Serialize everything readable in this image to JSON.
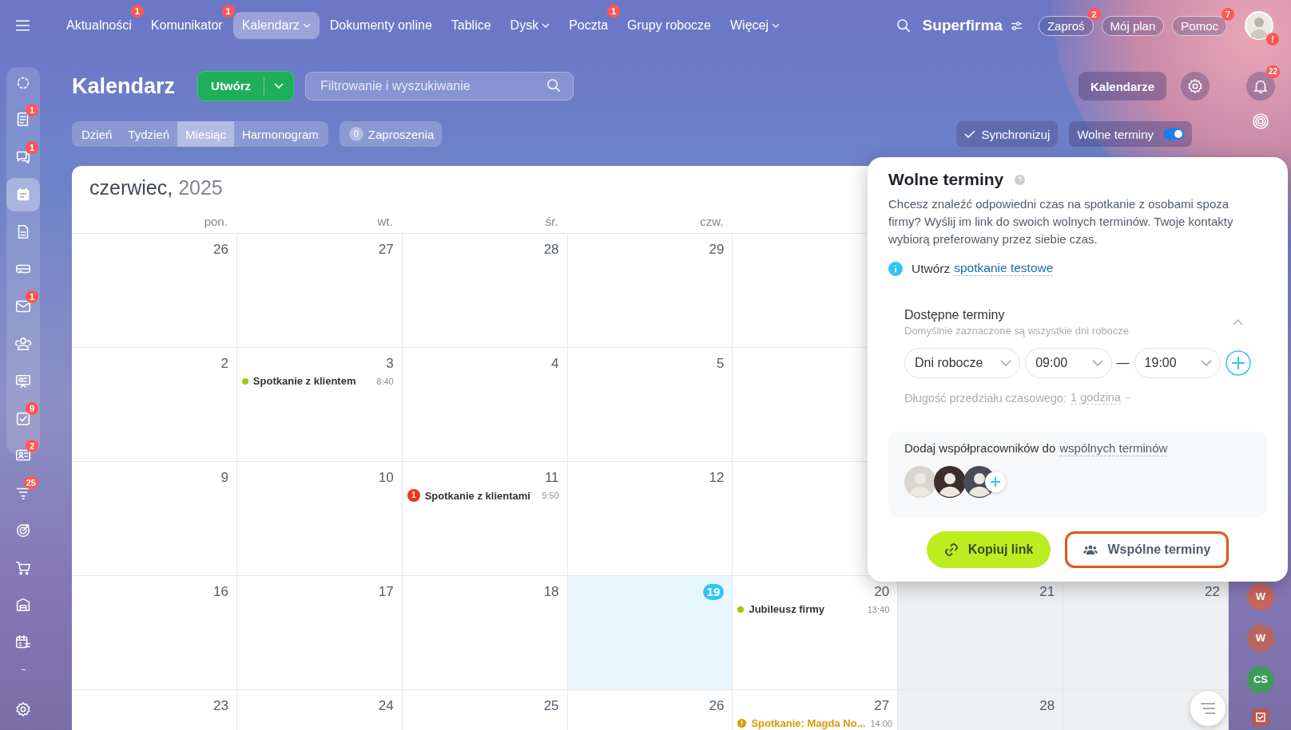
{
  "nav": {
    "items": [
      {
        "label": "Aktualności",
        "badge": "1",
        "selected": false,
        "has_menu": false
      },
      {
        "label": "Komunikator",
        "badge": "1",
        "selected": false,
        "has_menu": false
      },
      {
        "label": "Kalendarz",
        "selected": true,
        "has_menu": true
      },
      {
        "label": "Dokumenty online",
        "selected": false,
        "has_menu": false
      },
      {
        "label": "Tablice",
        "selected": false,
        "has_menu": false
      },
      {
        "label": "Dysk",
        "selected": false,
        "has_menu": true
      },
      {
        "label": "Poczta",
        "badge": "1",
        "selected": false,
        "has_menu": false
      },
      {
        "label": "Grupy robocze",
        "selected": false,
        "has_menu": false
      },
      {
        "label": "Więcej",
        "selected": false,
        "has_menu": true
      }
    ],
    "company": "Superfirma",
    "buttons": [
      {
        "label": "Zaproś",
        "badge": "2"
      },
      {
        "label": "Mój plan"
      },
      {
        "label": "Pomoc",
        "badge": "7"
      }
    ],
    "avatar_alert": "!"
  },
  "sidebar": {
    "items": [
      {
        "selected": false
      },
      {
        "selected": false,
        "badge": "1"
      },
      {
        "selected": false,
        "badge": "1"
      },
      {
        "selected": true
      },
      {
        "selected": false
      },
      {
        "selected": false
      },
      {
        "selected": false,
        "badge": "1"
      },
      {
        "selected": false
      },
      {
        "selected": false
      },
      {
        "selected": false,
        "badge": "9"
      },
      {
        "selected": false,
        "badge": "2"
      },
      {
        "selected": false,
        "badge": "25"
      },
      {
        "selected": false
      },
      {
        "selected": false
      },
      {
        "selected": false
      },
      {
        "selected": false
      },
      {
        "selected": false
      }
    ]
  },
  "header": {
    "title": "Kalendarz",
    "create_button": "Utwórz",
    "search": {
      "placeholder": "Filtrowanie i wyszukiwanie"
    },
    "calendars_button": "Kalendarze",
    "notifications_badge": "22"
  },
  "views": [
    {
      "label": "Dzień",
      "selected": false
    },
    {
      "label": "Tydzień",
      "selected": false
    },
    {
      "label": "Miesiąc",
      "selected": true
    },
    {
      "label": "Harmonogram",
      "selected": false
    }
  ],
  "invitations": {
    "count": "0",
    "label": "Zaproszenia"
  },
  "sync_button": "Synchronizuj",
  "free_slots_toggle": {
    "label": "Wolne terminy",
    "on": true
  },
  "calendar": {
    "month": "czerwiec,",
    "year": "2025",
    "weekdays": [
      "pon.",
      "wt.",
      "śr.",
      "czw."
    ],
    "weeks": [
      {
        "days": [
          {
            "day": "26",
            "today": false,
            "weekend": false
          },
          {
            "day": "27",
            "today": false,
            "weekend": false
          },
          {
            "day": "28",
            "today": false,
            "weekend": false
          },
          {
            "day": "29",
            "today": false,
            "weekend": false
          }
        ]
      },
      {
        "days": [
          {
            "day": "2",
            "today": false,
            "weekend": false
          },
          {
            "day": "3",
            "today": false,
            "weekend": false,
            "events": [
              {
                "title": "Spotkanie z klientem",
                "time": "8:40",
                "kind": "dot",
                "color": "#9dcf00"
              }
            ]
          },
          {
            "day": "4",
            "today": false,
            "weekend": false
          },
          {
            "day": "5",
            "today": false,
            "weekend": false
          }
        ]
      },
      {
        "days": [
          {
            "day": "9",
            "today": false,
            "weekend": false
          },
          {
            "day": "10",
            "today": false,
            "weekend": false
          },
          {
            "day": "11",
            "today": false,
            "weekend": false,
            "events": [
              {
                "title": "Spotkanie z klientami",
                "time": "9:50",
                "kind": "count",
                "count": "1",
                "color": "#f1361a"
              }
            ]
          },
          {
            "day": "12",
            "today": false,
            "weekend": false
          }
        ]
      },
      {
        "days": [
          {
            "day": "16",
            "today": false,
            "weekend": false
          },
          {
            "day": "17",
            "today": false,
            "weekend": false
          },
          {
            "day": "18",
            "today": false,
            "weekend": false
          },
          {
            "day": "19",
            "today": true,
            "weekend": false
          },
          {
            "day": "20",
            "today": false,
            "weekend": false,
            "events": [
              {
                "title": "Jubileusz firmy",
                "time": "13:40",
                "kind": "dot",
                "color": "#9dcf00"
              }
            ]
          },
          {
            "day": "21",
            "today": false,
            "weekend": true
          },
          {
            "day": "22",
            "today": false,
            "weekend": true
          }
        ]
      },
      {
        "days": [
          {
            "day": "23",
            "today": false,
            "weekend": false
          },
          {
            "day": "24",
            "today": false,
            "weekend": false
          },
          {
            "day": "25",
            "today": false,
            "weekend": false
          },
          {
            "day": "26",
            "today": false,
            "weekend": false
          },
          {
            "day": "27",
            "today": false,
            "weekend": false,
            "events": [
              {
                "title": "Spotkanie: Magda No...",
                "time": "14:00",
                "kind": "warning",
                "color": "#d99a00"
              }
            ]
          },
          {
            "day": "28",
            "today": false,
            "weekend": true
          }
        ]
      }
    ]
  },
  "free_slots_popup": {
    "title": "Wolne terminy",
    "description": "Chcesz znaleźć odpowiedni czas na spotkanie z osobami spoza firmy? Wyślij im link do swoich wolnych terminów. Twoje kontakty wybiorą preferowany przez siebie czas.",
    "test_meeting": {
      "prefix": "Utwórz",
      "link": "spotkanie testowe"
    },
    "available": {
      "title": "Dostępne terminy",
      "hint": "Domyślnie zaznaczone są wszystkie dni robocze",
      "expanded": true,
      "days_select": "Dni robocze",
      "from": "09:00",
      "separator": "—",
      "to": "19:00",
      "duration_label": "Długość przedziału czasowego:",
      "duration": "1 godzina"
    },
    "coworkers": {
      "prefix": "Dodaj współpracowników do",
      "link": "wspólnych terminów",
      "avatars": [
        {
          "kind": "photo"
        },
        {
          "kind": "photo"
        },
        {
          "kind": "photo"
        }
      ]
    },
    "buttons": [
      {
        "label": "Kopiuj link",
        "kind": "primary",
        "highlighted": false
      },
      {
        "label": "Wspólne terminy",
        "kind": "secondary",
        "highlighted": true
      }
    ]
  },
  "side_avatars": [
    {
      "initials": "W",
      "color": "#c4675f"
    },
    {
      "initials": "W",
      "color": "#b9655f"
    },
    {
      "initials": "CS",
      "color": "#3f9b5a"
    }
  ]
}
